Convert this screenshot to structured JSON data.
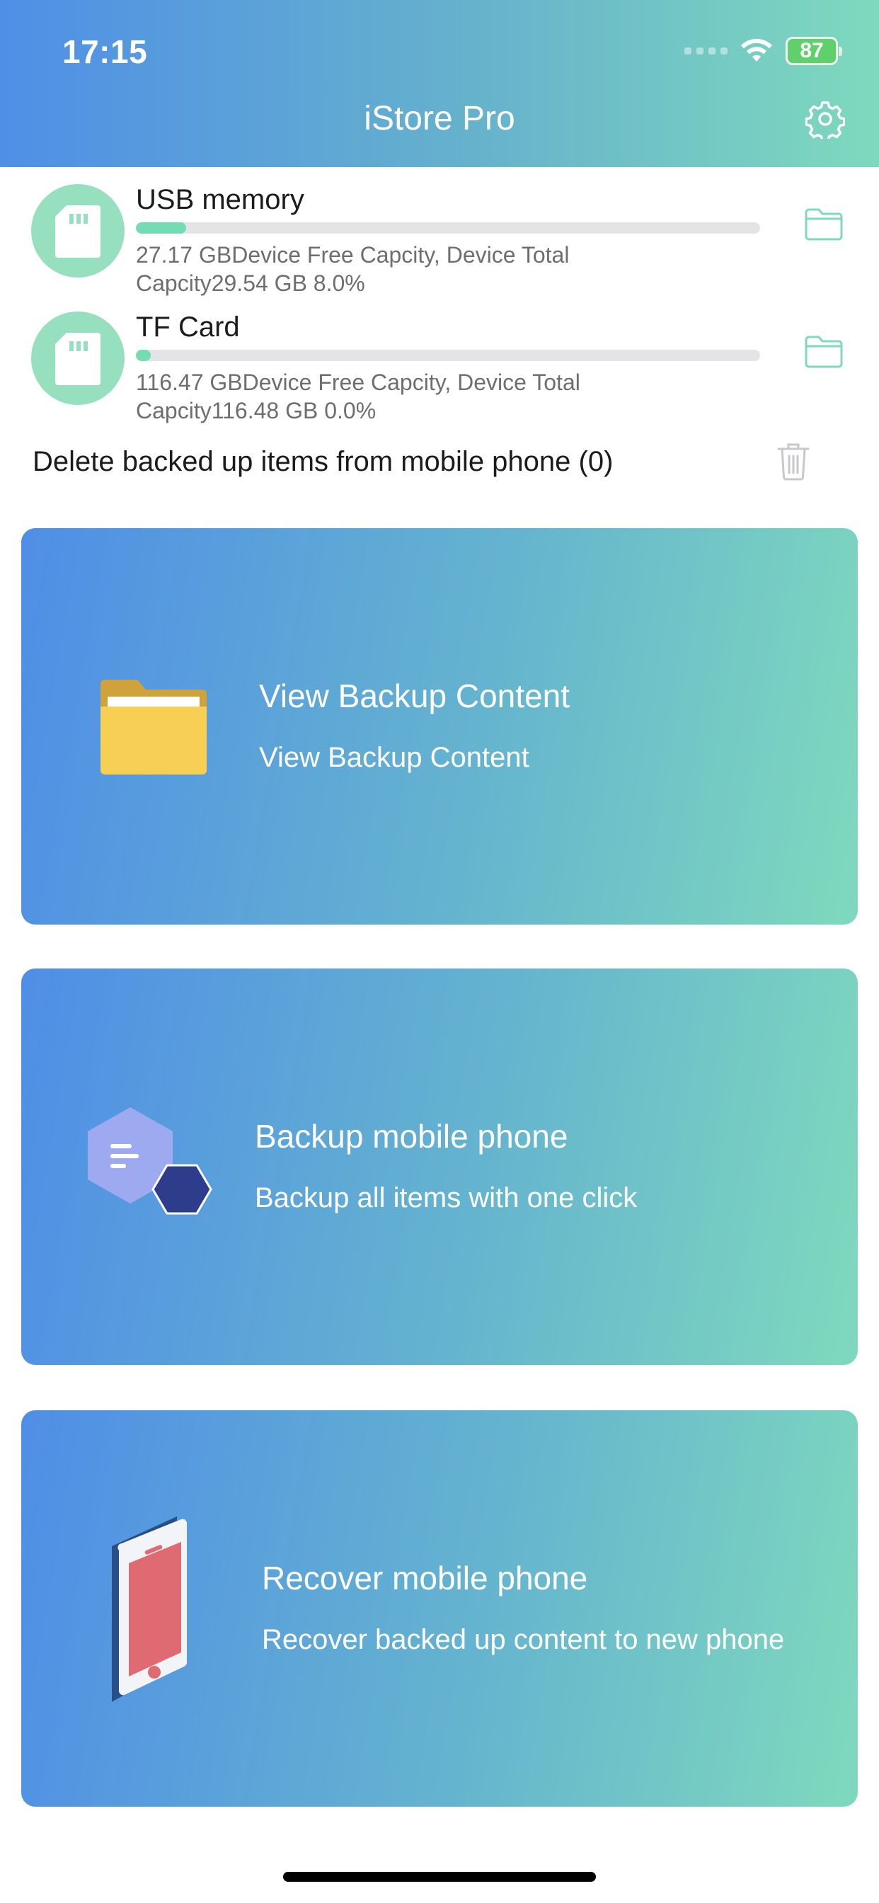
{
  "status_bar": {
    "time": "17:15",
    "battery": "87"
  },
  "header": {
    "title": "iStore Pro"
  },
  "storage": [
    {
      "name": "USB memory",
      "progress_percent": 8.0,
      "description": "27.17 GBDevice Free Capcity, Device Total Capcity29.54 GB 8.0%"
    },
    {
      "name": "TF Card",
      "progress_percent": 0.0,
      "description": "116.47 GBDevice Free Capcity, Device Total Capcity116.48 GB 0.0%"
    }
  ],
  "delete_row": {
    "label": "Delete backed up items from mobile phone (0)"
  },
  "cards": [
    {
      "title": "View Backup Content",
      "subtitle": "View Backup Content",
      "icon": "folder-icon"
    },
    {
      "title": "Backup mobile phone",
      "subtitle": "Backup all items with one click",
      "icon": "backup-hexagon-icon"
    },
    {
      "title": "Recover mobile phone",
      "subtitle": "Recover backed up content to new phone",
      "icon": "phone-icon"
    }
  ],
  "colors": {
    "header_gradient_start": "#4f8fe6",
    "header_gradient_end": "#7fd9bd",
    "progress_fill": "#74dbb2",
    "sd_circle": "#96dfbf"
  }
}
